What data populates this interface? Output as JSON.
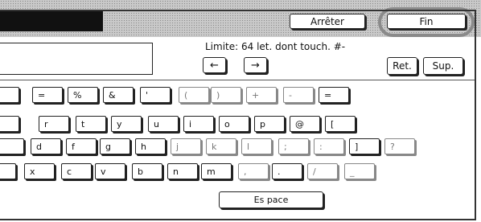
{
  "header": {
    "stop_label": "Arrêter",
    "end_label": "Fin"
  },
  "input": {
    "hint": "Limite: 64 let. dont touch. #-",
    "value": ""
  },
  "controls": {
    "left_arrow": "←",
    "right_arrow": "→",
    "ret_label": "Ret.",
    "sup_label": "Sup."
  },
  "keyboard": {
    "rows": [
      [
        "",
        "=",
        "%",
        "&",
        "'",
        "(",
        ")",
        "+",
        "-",
        "="
      ],
      [
        "e",
        "r",
        "t",
        "y",
        "u",
        "i",
        "o",
        "p",
        "@",
        "["
      ],
      [
        "",
        "d",
        "f",
        "g",
        "h",
        "j",
        "k",
        "l",
        ";",
        ":",
        "]",
        "?"
      ],
      [
        "",
        "x",
        "c",
        "v",
        "b",
        "n",
        "m",
        ",",
        ".",
        "/",
        "_"
      ]
    ],
    "space_label": "Es pace"
  }
}
